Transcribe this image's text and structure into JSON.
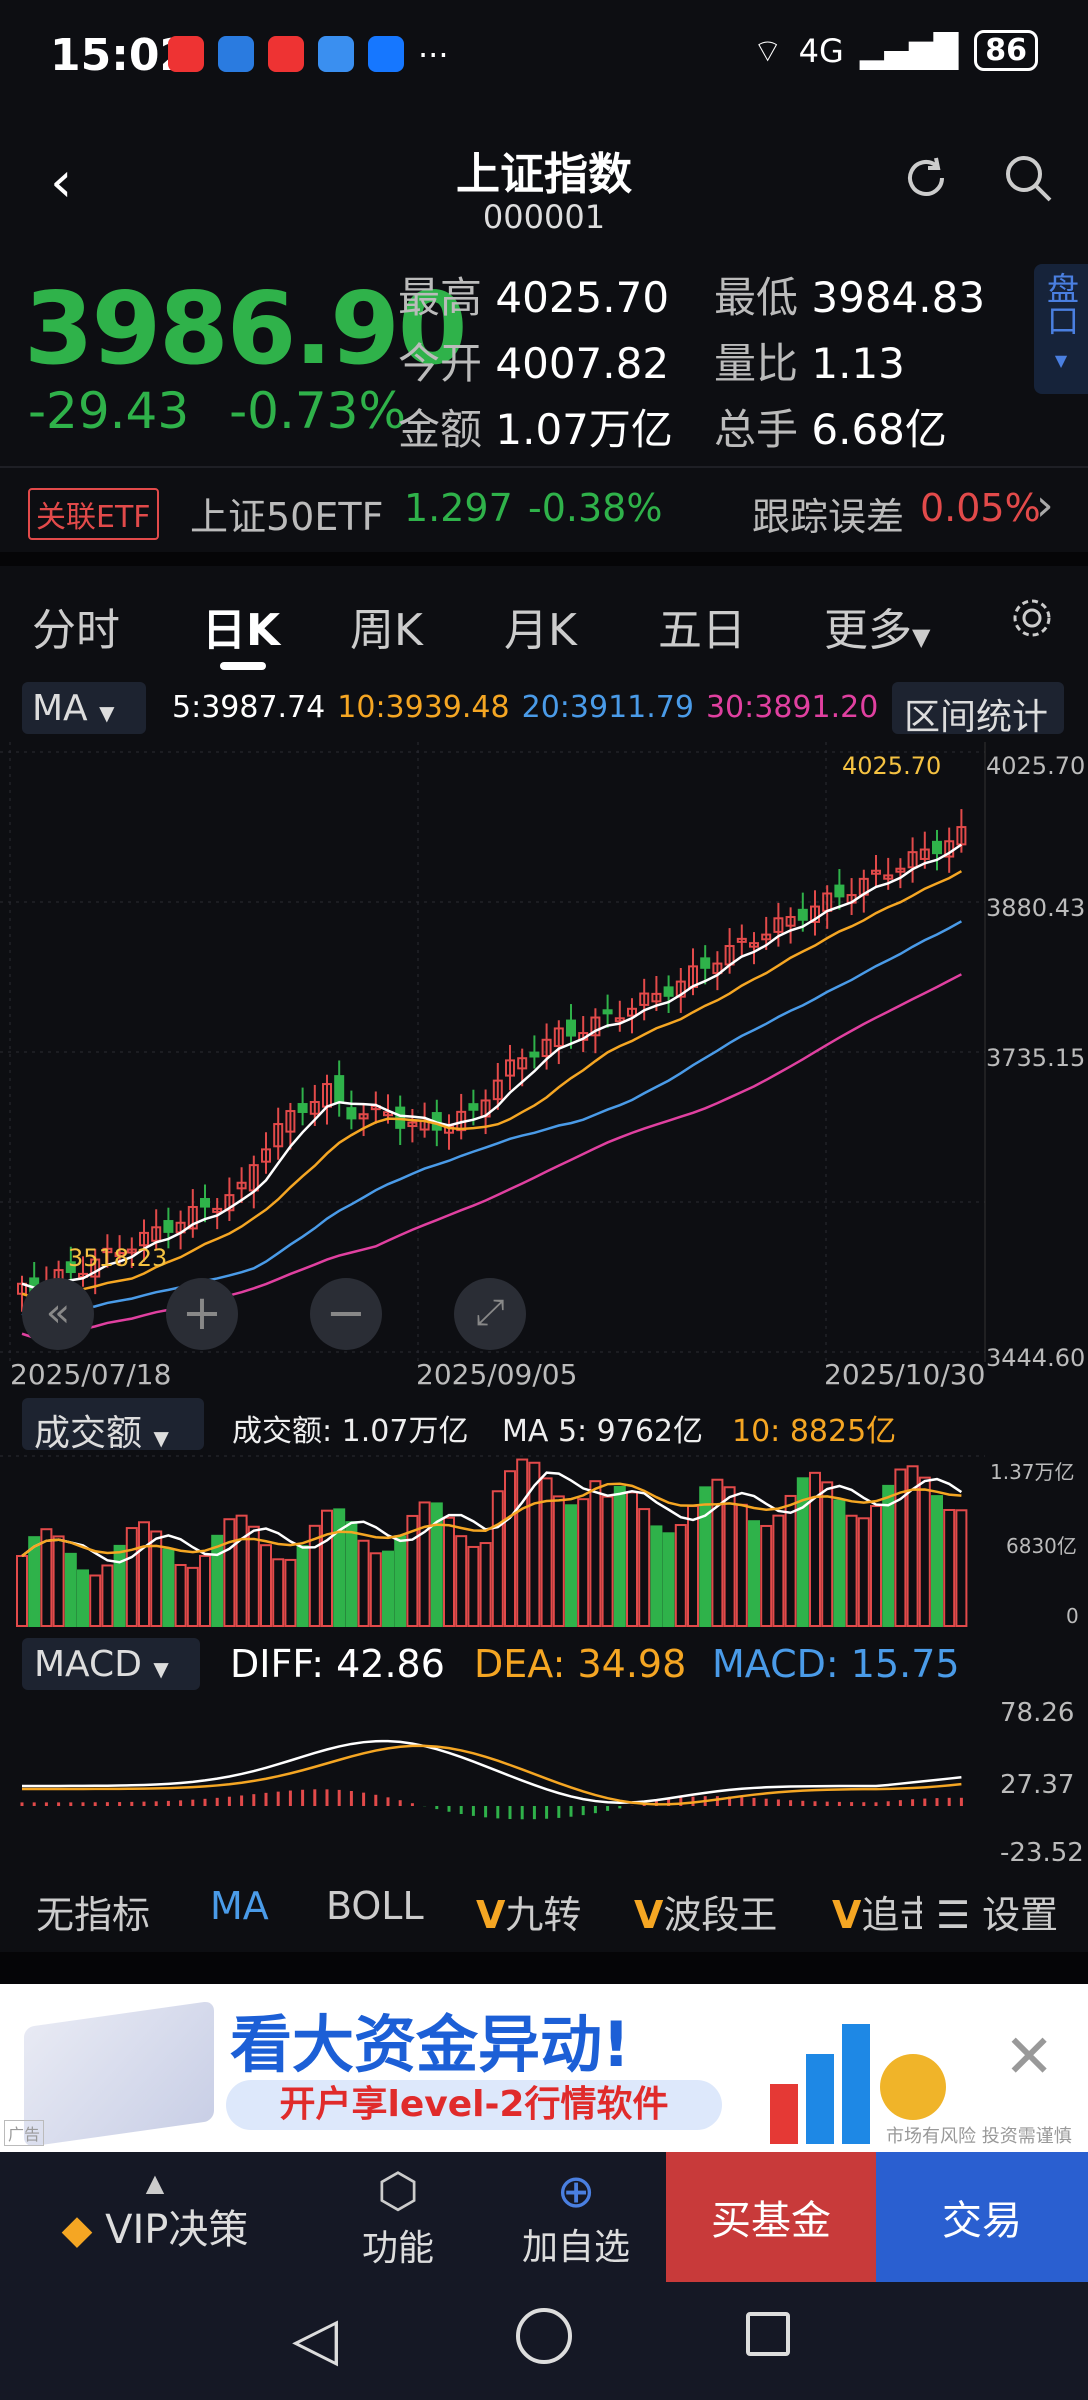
{
  "status": {
    "time": "15:02",
    "signal": "4G",
    "battery": "86"
  },
  "header": {
    "title": "上证指数",
    "code": "000001"
  },
  "quote": {
    "price": "3986.90",
    "change": "-29.43",
    "change_pct": "-0.73%",
    "high_label": "最高",
    "high": "4025.70",
    "low_label": "最低",
    "low": "3984.83",
    "open_label": "今开",
    "open": "4007.82",
    "volratio_label": "量比",
    "volratio": "1.13",
    "amount_label": "金额",
    "amount": "1.07万亿",
    "hands_label": "总手",
    "hands": "6.68亿",
    "pankou": "盘口"
  },
  "etf": {
    "tag": "关联ETF",
    "name": "上证50ETF",
    "price": "1.297",
    "pct": "-0.38%",
    "track_label": "跟踪误差",
    "track_val": "0.05%"
  },
  "tabs": [
    "分时",
    "日K",
    "周K",
    "月K",
    "五日",
    "更多"
  ],
  "ma_row": {
    "selector": "MA",
    "ma5": "5:3987.74",
    "ma10": "10:3939.48",
    "ma20": "20:3911.79",
    "ma30": "30:3891.20",
    "stats_button": "区间统计"
  },
  "kchart": {
    "y_ticks": [
      "4025.70",
      "3880.43",
      "3735.15",
      "3444.60"
    ],
    "high_marker": "4025.70",
    "low_marker": "3518.23",
    "dates": [
      "2025/07/18",
      "2025/09/05",
      "2025/10/30"
    ]
  },
  "volume": {
    "selector": "成交额",
    "label": "成交额: 1.07万亿",
    "ma5": "MA 5: 9762亿",
    "ma10": "10: 8825亿",
    "y_ticks": [
      "1.37万亿",
      "6830亿",
      "0"
    ]
  },
  "macd": {
    "selector": "MACD",
    "diff": "DIFF: 42.86",
    "dea": "DEA: 34.98",
    "macd": "MACD: 15.75",
    "y_ticks": [
      "78.26",
      "27.37",
      "-23.52"
    ]
  },
  "indicators": [
    "无指标",
    "MA",
    "BOLL",
    "九转",
    "波段王",
    "追击",
    "设置"
  ],
  "ad": {
    "headline": "看大资金异动!",
    "sub": "开户享level-2行情软件",
    "risk": "市场有风险 投资需谨慎",
    "tag": "广告"
  },
  "bottom_nav": {
    "vip": "VIP决策",
    "func": "功能",
    "add": "加自选",
    "buy": "买基金",
    "trade": "交易"
  },
  "colors": {
    "up": "#e24a4a",
    "down": "#2fb24a",
    "ma5": "#ffffff",
    "ma10": "#f5a623",
    "ma20": "#4a9be8",
    "ma30": "#e040a0"
  }
}
